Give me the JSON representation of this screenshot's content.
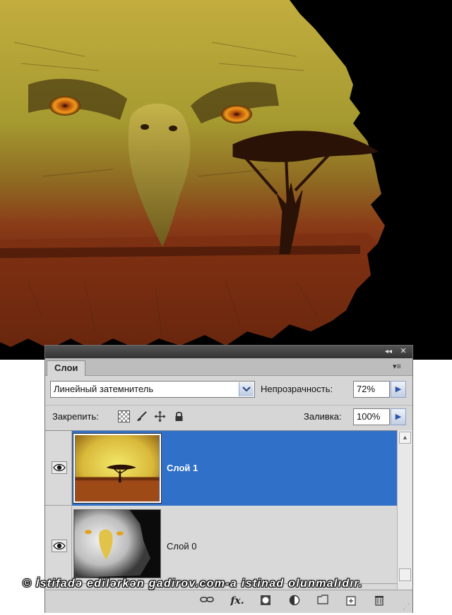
{
  "colors": {
    "selection_blue": "#3170c9",
    "panel_bg": "#d6d6d6",
    "artwork_yellow": "#b9a338",
    "artwork_rust": "#8b3f16"
  },
  "artwork": {
    "icon": "eagle-tree-composite-image"
  },
  "panel": {
    "tab_label": "Слои",
    "menu_icon": "panel-menu-icon",
    "blend_mode": "Линейный затемнитель",
    "opacity_label": "Непрозрачность:",
    "opacity_value": "72%",
    "lock_label": "Закрепить:",
    "fill_label": "Заливка:",
    "fill_value": "100%"
  },
  "layers": [
    {
      "name": "Слой 1",
      "selected": true,
      "visible": true,
      "thumbnail": "savanna-tree-thumbnail"
    },
    {
      "name": "Слой 0",
      "selected": false,
      "visible": true,
      "thumbnail": "eagle-bw-thumbnail"
    }
  ],
  "bottom_bar": {
    "buttons": [
      "link-layers-icon",
      "fx-icon",
      "mask-icon",
      "adjustment-icon",
      "group-folder-icon",
      "new-layer-icon",
      "trash-icon"
    ]
  },
  "watermark": "© İstifadə edilərkən gadirov.com-a istinad olunmalıdır."
}
